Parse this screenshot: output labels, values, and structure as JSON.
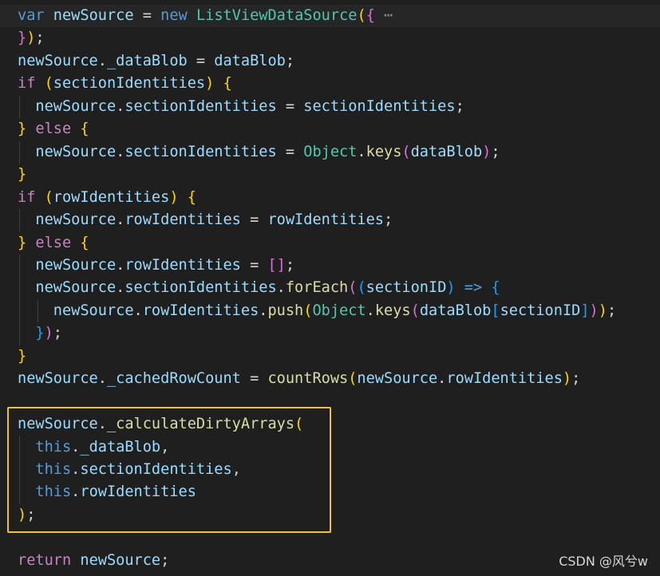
{
  "editor": {
    "lines": [
      {
        "tokens": [
          [
            "var",
            "k-storage"
          ],
          [
            " ",
            "p"
          ],
          [
            "newSource",
            "v"
          ],
          [
            " = ",
            "p"
          ],
          [
            "new",
            "k-storage"
          ],
          [
            " ",
            "p"
          ],
          [
            "ListViewDataSource",
            "cls"
          ],
          [
            "(",
            "b1"
          ],
          [
            "{",
            "b2"
          ],
          [
            " ",
            "p"
          ],
          [
            "⋯",
            "fold"
          ]
        ]
      },
      {
        "tokens": [
          [
            "}",
            "b2"
          ],
          [
            ")",
            "b1"
          ],
          [
            ";",
            "p"
          ]
        ]
      },
      {
        "tokens": [
          [
            "newSource",
            "v"
          ],
          [
            ".",
            "p"
          ],
          [
            "_dataBlob",
            "v"
          ],
          [
            " = ",
            "p"
          ],
          [
            "dataBlob",
            "v"
          ],
          [
            ";",
            "p"
          ]
        ]
      },
      {
        "tokens": [
          [
            "if",
            "k-control"
          ],
          [
            " ",
            "p"
          ],
          [
            "(",
            "b1"
          ],
          [
            "sectionIdentities",
            "v"
          ],
          [
            ")",
            "b1"
          ],
          [
            " ",
            "p"
          ],
          [
            "{",
            "b1"
          ]
        ]
      },
      {
        "tokens": [
          [
            "  ",
            "p"
          ],
          [
            "newSource",
            "v"
          ],
          [
            ".",
            "p"
          ],
          [
            "sectionIdentities",
            "v"
          ],
          [
            " = ",
            "p"
          ],
          [
            "sectionIdentities",
            "v"
          ],
          [
            ";",
            "p"
          ]
        ]
      },
      {
        "tokens": [
          [
            "}",
            "b1"
          ],
          [
            " ",
            "p"
          ],
          [
            "else",
            "k-control"
          ],
          [
            " ",
            "p"
          ],
          [
            "{",
            "b1"
          ]
        ]
      },
      {
        "tokens": [
          [
            "  ",
            "p"
          ],
          [
            "newSource",
            "v"
          ],
          [
            ".",
            "p"
          ],
          [
            "sectionIdentities",
            "v"
          ],
          [
            " = ",
            "p"
          ],
          [
            "Object",
            "cls"
          ],
          [
            ".",
            "p"
          ],
          [
            "keys",
            "fn"
          ],
          [
            "(",
            "b2"
          ],
          [
            "dataBlob",
            "v"
          ],
          [
            ")",
            "b2"
          ],
          [
            ";",
            "p"
          ]
        ]
      },
      {
        "tokens": [
          [
            "}",
            "b1"
          ]
        ]
      },
      {
        "tokens": [
          [
            "if",
            "k-control"
          ],
          [
            " ",
            "p"
          ],
          [
            "(",
            "b1"
          ],
          [
            "rowIdentities",
            "v"
          ],
          [
            ")",
            "b1"
          ],
          [
            " ",
            "p"
          ],
          [
            "{",
            "b1"
          ]
        ]
      },
      {
        "tokens": [
          [
            "  ",
            "p"
          ],
          [
            "newSource",
            "v"
          ],
          [
            ".",
            "p"
          ],
          [
            "rowIdentities",
            "v"
          ],
          [
            " = ",
            "p"
          ],
          [
            "rowIdentities",
            "v"
          ],
          [
            ";",
            "p"
          ]
        ]
      },
      {
        "tokens": [
          [
            "}",
            "b1"
          ],
          [
            " ",
            "p"
          ],
          [
            "else",
            "k-control"
          ],
          [
            " ",
            "p"
          ],
          [
            "{",
            "b1"
          ]
        ]
      },
      {
        "tokens": [
          [
            "  ",
            "p"
          ],
          [
            "newSource",
            "v"
          ],
          [
            ".",
            "p"
          ],
          [
            "rowIdentities",
            "v"
          ],
          [
            " = ",
            "p"
          ],
          [
            "[",
            "b2"
          ],
          [
            "]",
            "b2"
          ],
          [
            ";",
            "p"
          ]
        ]
      },
      {
        "tokens": [
          [
            "  ",
            "p"
          ],
          [
            "newSource",
            "v"
          ],
          [
            ".",
            "p"
          ],
          [
            "sectionIdentities",
            "v"
          ],
          [
            ".",
            "p"
          ],
          [
            "forEach",
            "fn"
          ],
          [
            "(",
            "b2"
          ],
          [
            "(",
            "b3"
          ],
          [
            "sectionID",
            "v"
          ],
          [
            ")",
            "b3"
          ],
          [
            " ",
            "p"
          ],
          [
            "=>",
            "k-storage"
          ],
          [
            " ",
            "p"
          ],
          [
            "{",
            "b3"
          ]
        ]
      },
      {
        "tokens": [
          [
            "    ",
            "p"
          ],
          [
            "newSource",
            "v"
          ],
          [
            ".",
            "p"
          ],
          [
            "rowIdentities",
            "v"
          ],
          [
            ".",
            "p"
          ],
          [
            "push",
            "fn"
          ],
          [
            "(",
            "b1"
          ],
          [
            "Object",
            "cls"
          ],
          [
            ".",
            "p"
          ],
          [
            "keys",
            "fn"
          ],
          [
            "(",
            "b2"
          ],
          [
            "dataBlob",
            "v"
          ],
          [
            "[",
            "b3"
          ],
          [
            "sectionID",
            "v"
          ],
          [
            "]",
            "b3"
          ],
          [
            ")",
            "b2"
          ],
          [
            ")",
            "b1"
          ],
          [
            ";",
            "p"
          ]
        ]
      },
      {
        "tokens": [
          [
            "  ",
            "p"
          ],
          [
            "}",
            "b3"
          ],
          [
            ")",
            "b2"
          ],
          [
            ";",
            "p"
          ]
        ]
      },
      {
        "tokens": [
          [
            "}",
            "b1"
          ]
        ]
      },
      {
        "tokens": [
          [
            "newSource",
            "v"
          ],
          [
            ".",
            "p"
          ],
          [
            "_cachedRowCount",
            "v"
          ],
          [
            " = ",
            "p"
          ],
          [
            "countRows",
            "fn"
          ],
          [
            "(",
            "b1"
          ],
          [
            "newSource",
            "v"
          ],
          [
            ".",
            "p"
          ],
          [
            "rowIdentities",
            "v"
          ],
          [
            ")",
            "b1"
          ],
          [
            ";",
            "p"
          ]
        ]
      },
      {
        "tokens": []
      },
      {
        "tokens": [
          [
            "newSource",
            "v"
          ],
          [
            ".",
            "p"
          ],
          [
            "_calculateDirtyArrays",
            "fn"
          ],
          [
            "(",
            "b1"
          ]
        ]
      },
      {
        "tokens": [
          [
            "  ",
            "p"
          ],
          [
            "this",
            "k-storage"
          ],
          [
            ".",
            "p"
          ],
          [
            "_dataBlob",
            "v"
          ],
          [
            ",",
            "p"
          ]
        ]
      },
      {
        "tokens": [
          [
            "  ",
            "p"
          ],
          [
            "this",
            "k-storage"
          ],
          [
            ".",
            "p"
          ],
          [
            "sectionIdentities",
            "v"
          ],
          [
            ",",
            "p"
          ]
        ]
      },
      {
        "tokens": [
          [
            "  ",
            "p"
          ],
          [
            "this",
            "k-storage"
          ],
          [
            ".",
            "p"
          ],
          [
            "rowIdentities",
            "v"
          ]
        ]
      },
      {
        "tokens": [
          [
            ")",
            "b1"
          ],
          [
            ";",
            "p"
          ]
        ]
      },
      {
        "tokens": []
      },
      {
        "tokens": [
          [
            "return",
            "k-control"
          ],
          [
            " ",
            "p"
          ],
          [
            "newSource",
            "v"
          ],
          [
            ";",
            "p"
          ]
        ]
      }
    ]
  },
  "watermark": "CSDN @风兮w"
}
